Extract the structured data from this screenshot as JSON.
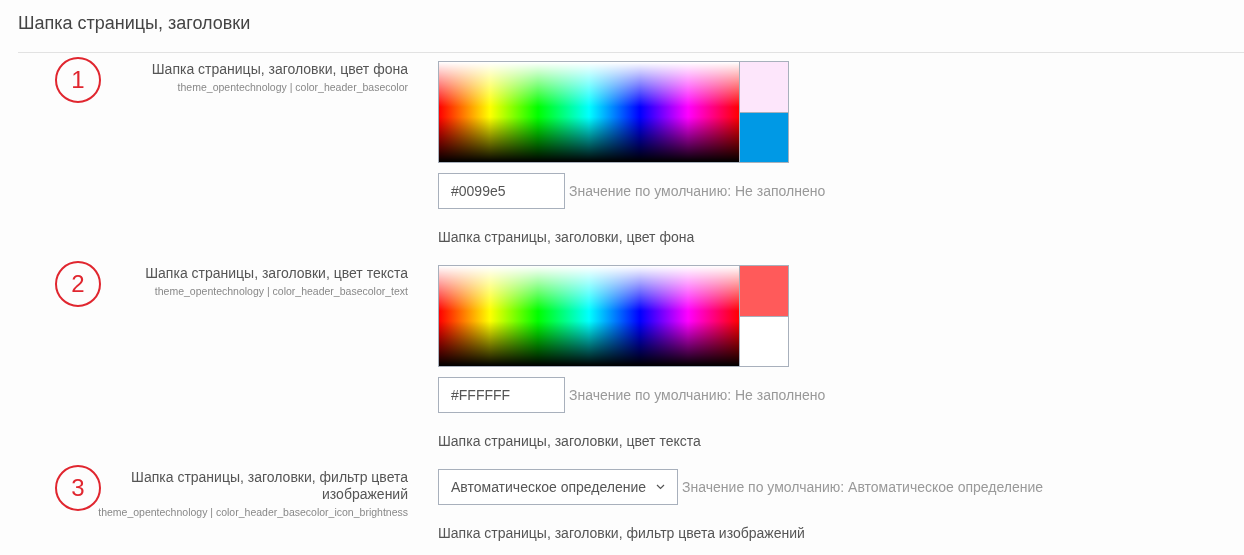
{
  "section_title": "Шапка страницы, заголовки",
  "settings": [
    {
      "kind": "color",
      "number": "1",
      "label": "Шапка страницы, заголовки, цвет фона",
      "key": "theme_opentechnology | color_header_basecolor",
      "swatches": [
        {
          "color": "#fde6fb"
        },
        {
          "color": "#0099e5"
        }
      ],
      "value": "#0099e5",
      "default": "Значение по умолчанию: Не заполнено",
      "description": "Шапка страницы, заголовки, цвет фона"
    },
    {
      "kind": "color",
      "number": "2",
      "label": "Шапка страницы, заголовки, цвет текста",
      "key": "theme_opentechnology | color_header_basecolor_text",
      "swatches": [
        {
          "color": "#ff5a5a"
        },
        {
          "color": "#ffffff"
        }
      ],
      "value": "#FFFFFF",
      "default": "Значение по умолчанию: Не заполнено",
      "description": "Шапка страницы, заголовки, цвет текста"
    },
    {
      "kind": "select",
      "number": "3",
      "label": "Шапка страницы, заголовки, фильтр цвета изображений",
      "key": "theme_opentechnology | color_header_basecolor_icon_brightness",
      "value": "Автоматическое определение",
      "default": "Значение по умолчанию: Автоматическое определение",
      "description": "Шапка страницы, заголовки, фильтр цвета изображений"
    }
  ]
}
